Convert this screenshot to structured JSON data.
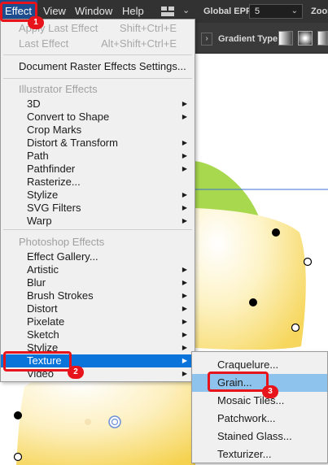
{
  "menubar": {
    "items": [
      {
        "label": "Effect"
      },
      {
        "label": "View"
      },
      {
        "label": "Window"
      },
      {
        "label": "Help"
      }
    ],
    "workspace_chevron": "⌄",
    "global_epf_label": "Global EPF:",
    "global_epf_value": "5",
    "zoom_label": "Zoom"
  },
  "control_bar": {
    "gradient_type_label": "Gradient Type:",
    "arrow": "›"
  },
  "effect_menu": {
    "apply_last": {
      "label": "Apply Last Effect",
      "shortcut": "Shift+Ctrl+E"
    },
    "last_effect": {
      "label": "Last Effect",
      "shortcut": "Alt+Shift+Ctrl+E"
    },
    "doc_raster": {
      "label": "Document Raster Effects Settings..."
    },
    "illustrator_header": "Illustrator Effects",
    "illustrator_items": [
      {
        "label": "3D",
        "submenu": true
      },
      {
        "label": "Convert to Shape",
        "submenu": true
      },
      {
        "label": "Crop Marks",
        "submenu": false
      },
      {
        "label": "Distort & Transform",
        "submenu": true
      },
      {
        "label": "Path",
        "submenu": true
      },
      {
        "label": "Pathfinder",
        "submenu": true
      },
      {
        "label": "Rasterize...",
        "submenu": false
      },
      {
        "label": "Stylize",
        "submenu": true
      },
      {
        "label": "SVG Filters",
        "submenu": true
      },
      {
        "label": "Warp",
        "submenu": true
      }
    ],
    "photoshop_header": "Photoshop Effects",
    "photoshop_items": [
      {
        "label": "Effect Gallery...",
        "submenu": false
      },
      {
        "label": "Artistic",
        "submenu": true
      },
      {
        "label": "Blur",
        "submenu": true
      },
      {
        "label": "Brush Strokes",
        "submenu": true
      },
      {
        "label": "Distort",
        "submenu": true
      },
      {
        "label": "Pixelate",
        "submenu": true
      },
      {
        "label": "Sketch",
        "submenu": true
      },
      {
        "label": "Stylize",
        "submenu": true
      },
      {
        "label": "Texture",
        "submenu": true,
        "highlighted": true
      },
      {
        "label": "Video",
        "submenu": true
      }
    ],
    "arrow_glyph": "▶"
  },
  "texture_submenu": {
    "items": [
      {
        "label": "Craquelure..."
      },
      {
        "label": "Grain...",
        "highlighted": true
      },
      {
        "label": "Mosaic Tiles..."
      },
      {
        "label": "Patchwork..."
      },
      {
        "label": "Stained Glass..."
      },
      {
        "label": "Texturizer..."
      }
    ]
  },
  "annotations": {
    "badge_1": "1",
    "badge_2": "2",
    "badge_3": "3"
  },
  "colors": {
    "accent_red": "#e8141b",
    "menu_highlight": "#0a74da",
    "submenu_highlight": "#8ec3ee",
    "leaf_green": "#a8d84e",
    "lemon_yellow": "#f7dc6f"
  }
}
